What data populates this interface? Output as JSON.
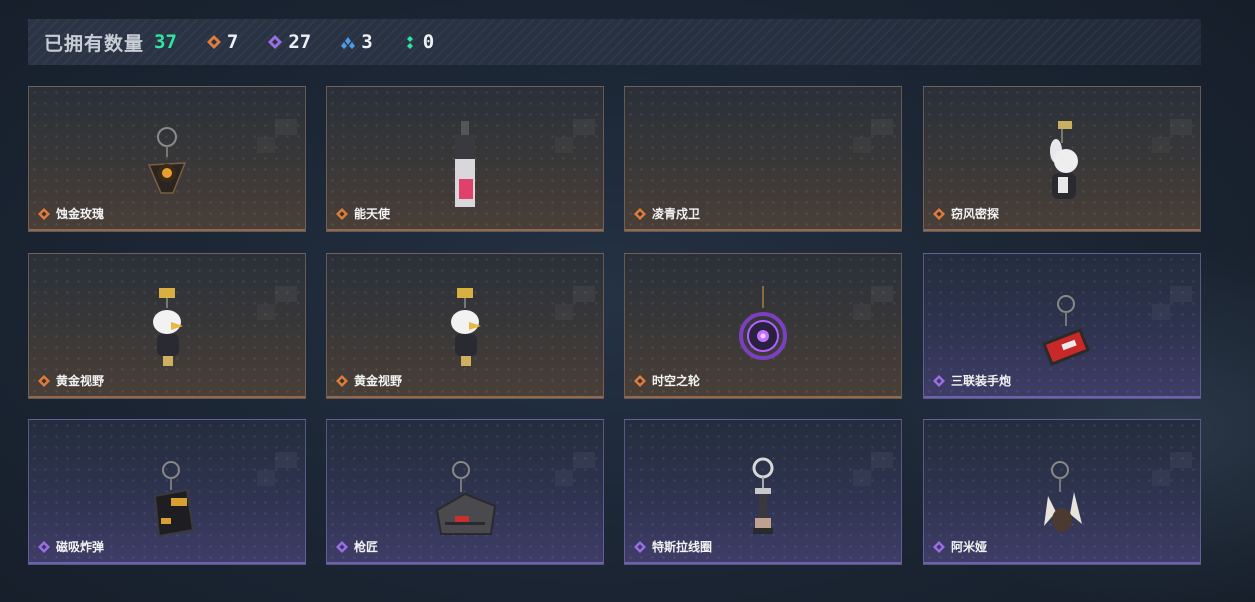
{
  "header": {
    "owned_label": "已拥有数量",
    "owned_count": "37",
    "stats": [
      {
        "icon": "orange-rarity-icon",
        "color": "#e07c3c",
        "value": "7"
      },
      {
        "icon": "purple-rarity-icon",
        "color": "#9b6ee8",
        "value": "27"
      },
      {
        "icon": "blue-rarity-icon",
        "color": "#4f9be8",
        "value": "3"
      },
      {
        "icon": "green-rarity-icon",
        "color": "#2fe6a4",
        "value": "0"
      }
    ]
  },
  "items": [
    {
      "name": "蚀金玫瑰",
      "rarity": "orange",
      "art": "rose-charm-icon"
    },
    {
      "name": "能天使",
      "rarity": "orange",
      "art": "exusiai-charm-icon"
    },
    {
      "name": "凌青戍卫",
      "rarity": "orange",
      "art": "empty"
    },
    {
      "name": "窃风密探",
      "rarity": "orange",
      "art": "rabbit-figure-charm-icon"
    },
    {
      "name": "黄金视野",
      "rarity": "orange",
      "art": "bird-figure-charm-icon"
    },
    {
      "name": "黄金视野",
      "rarity": "orange",
      "art": "bird-figure-charm-icon"
    },
    {
      "name": "时空之轮",
      "rarity": "orange",
      "art": "time-wheel-charm-icon"
    },
    {
      "name": "三联装手炮",
      "rarity": "purple",
      "art": "hand-cannon-charm-icon"
    },
    {
      "name": "磁吸炸弹",
      "rarity": "purple",
      "art": "bomb-charm-icon"
    },
    {
      "name": "枪匠",
      "rarity": "purple",
      "art": "gunsmith-box-charm-icon"
    },
    {
      "name": "特斯拉线圈",
      "rarity": "purple",
      "art": "tesla-coil-charm-icon"
    },
    {
      "name": "阿米娅",
      "rarity": "purple",
      "art": "amiya-charm-icon"
    }
  ],
  "colors": {
    "orange": "#e07c3c",
    "purple": "#9b6ee8",
    "accent_green": "#2fe6a4"
  }
}
